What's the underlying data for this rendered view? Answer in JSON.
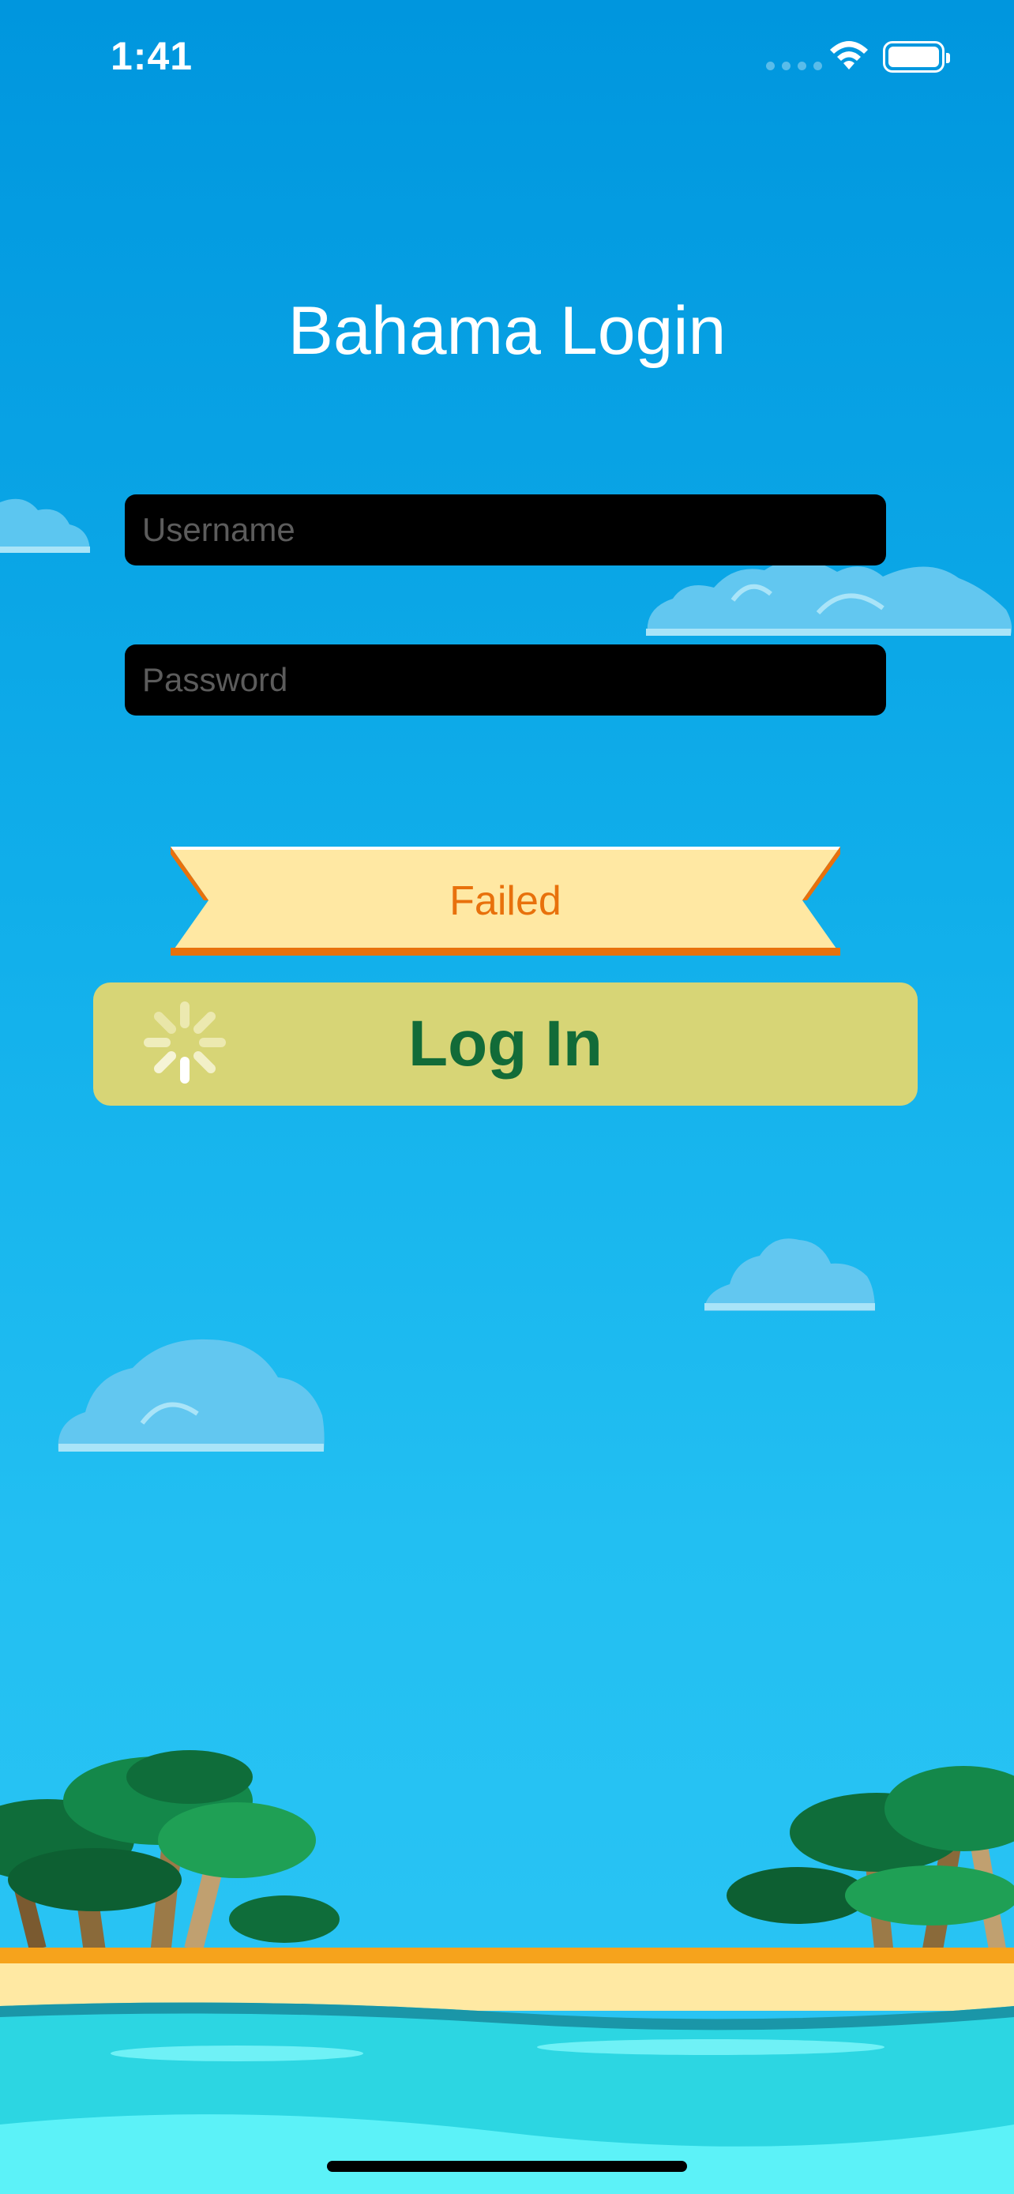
{
  "status_bar": {
    "time": "1:41"
  },
  "login": {
    "title": "Bahama Login",
    "username_placeholder": "Username",
    "password_placeholder": "Password",
    "status_message": "Failed",
    "login_button": "Log In"
  },
  "colors": {
    "sky_top": "#0096de",
    "sky_bottom": "#2cc6f4",
    "field_bg": "#000000",
    "banner_fill": "#ffe8a3",
    "banner_text": "#e8710c",
    "button_bg": "#d7d576",
    "button_text": "#126b38"
  }
}
